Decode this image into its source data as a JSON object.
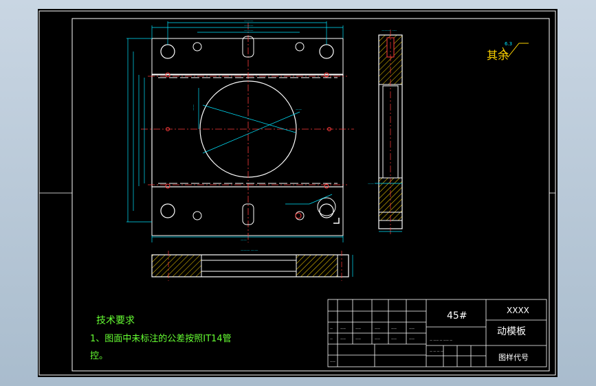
{
  "roughness": {
    "label": "其余",
    "value": "6.3"
  },
  "tech_requirements": {
    "title": "技术要求",
    "line1": "1、图面中未标注的公差按照IT14管",
    "line2": "控。"
  },
  "title_block": {
    "material": "45#",
    "company": "XXXX",
    "part_name": "动模板",
    "drawing_no_label": "图样代号"
  },
  "colors": {
    "background": "#000000",
    "outline": "#ffffff",
    "centerline": "#ff3b3b",
    "dimension": "#00e5ff",
    "hatch": "#ffd400",
    "text": "#66ff33",
    "hidden": "#ff3bff"
  }
}
